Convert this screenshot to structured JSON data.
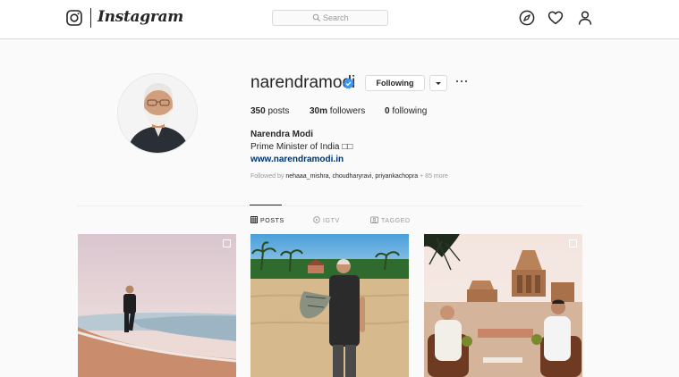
{
  "brand": {
    "wordmark": "Instagram"
  },
  "search": {
    "placeholder": "Search"
  },
  "nav": {
    "icons": [
      "compass-icon",
      "heart-icon",
      "person-icon"
    ]
  },
  "profile": {
    "username": "narendramodi",
    "verified": true,
    "follow_button": "Following",
    "stats": {
      "posts_count": "350",
      "posts_label": "posts",
      "followers_count": "30m",
      "followers_label": "followers",
      "following_count": "0",
      "following_label": "following"
    },
    "full_name": "Narendra Modi",
    "bio": "Prime Minister of India □□",
    "website": "www.narendramodi.in",
    "followed_by_prefix": "Followed by",
    "followed_by_names": "nehaaa_mishra, choudharyravi, priyankachopra",
    "followed_by_more": "+ 85 more"
  },
  "tabs": [
    {
      "label": "POSTS",
      "active": true
    },
    {
      "label": "IGTV",
      "active": false
    },
    {
      "label": "TAGGED",
      "active": false
    }
  ],
  "colors": {
    "link": "#003569",
    "verified": "#3897f0",
    "border": "#dbdbdb",
    "muted": "#999999"
  }
}
